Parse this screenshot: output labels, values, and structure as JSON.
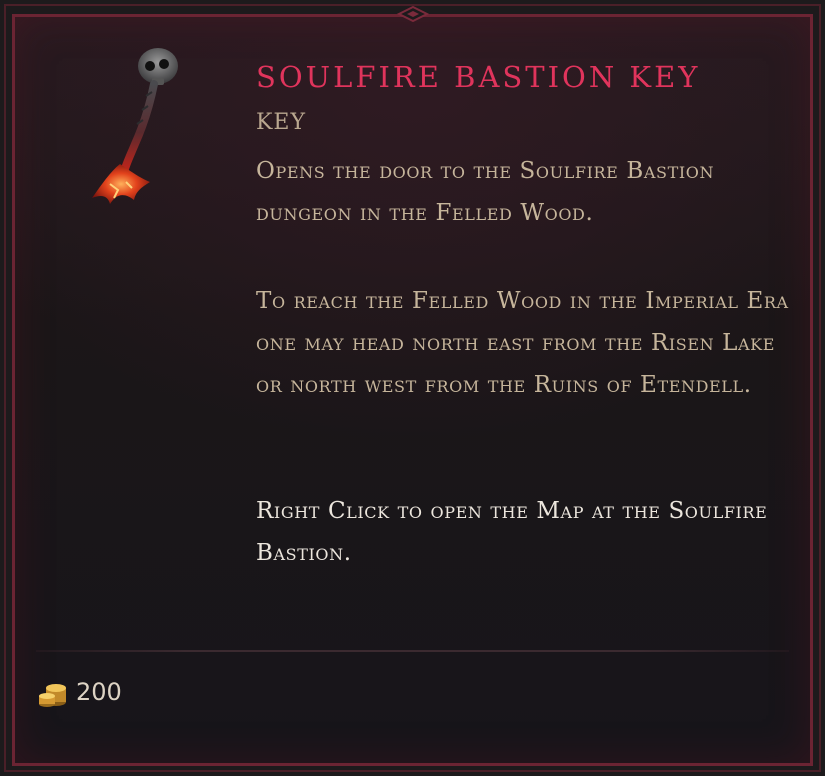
{
  "item": {
    "name": "Soulfire Bastion Key",
    "type": "Key",
    "description_1": "Opens the door to the Soulfire Bastion dungeon in the Felled Wood.",
    "description_2": "To reach the Felled Wood in the Imperial Era one may head north east from the Risen Lake or north west from the Ruins of Etendell.",
    "action_hint": "Right Click to open the Map at the Soulfire Bastion.",
    "icon": "skull-key-icon"
  },
  "value": {
    "gold": "200",
    "icon": "gold-coins-icon"
  },
  "colors": {
    "title": "#e0345c",
    "border": "#6b2433",
    "text": "#c6b59b",
    "action_text": "#ece6dd"
  }
}
